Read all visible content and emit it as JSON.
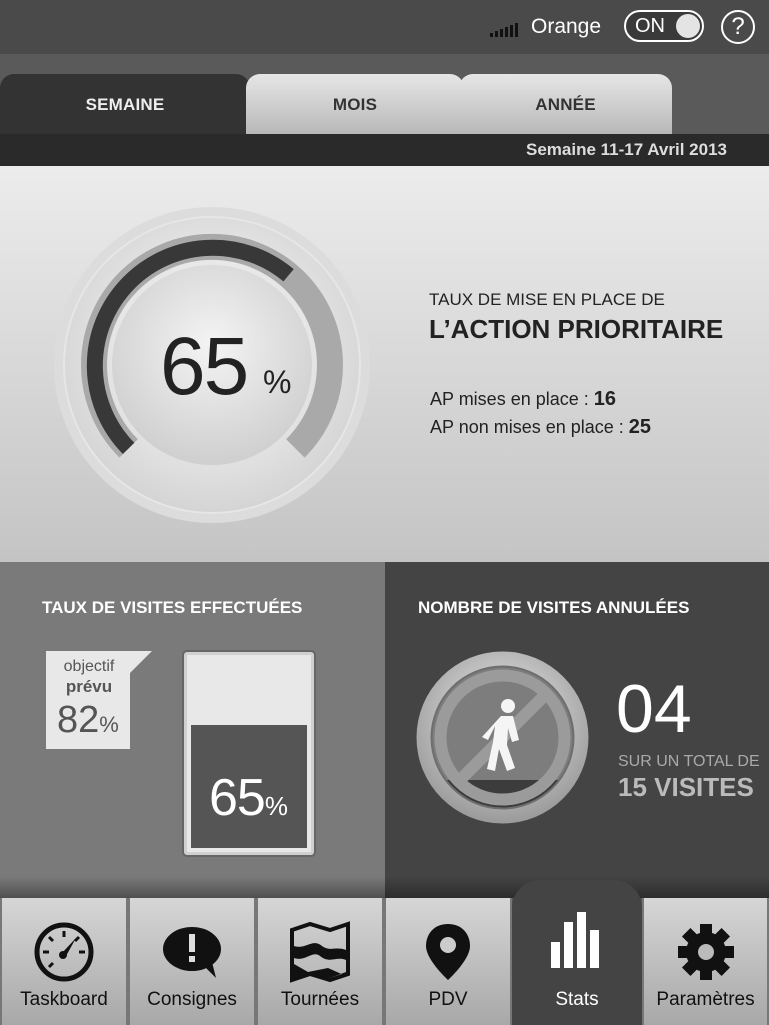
{
  "status": {
    "carrier": "Orange",
    "toggle_label": "ON",
    "help_label": "?"
  },
  "tabs": [
    {
      "label": "SEMAINE",
      "active": true
    },
    {
      "label": "MOIS",
      "active": false
    },
    {
      "label": "ANNÉE",
      "active": false
    }
  ],
  "period": "Semaine 11-17 Avril 2013",
  "action": {
    "percent": "65",
    "percent_symbol": "%",
    "percent_value": 0.65,
    "label": "TAUX DE MISE EN PLACE DE",
    "title": "L’ACTION PRIORITAIRE",
    "mises_label": "AP mises en place :",
    "mises_value": "16",
    "non_mises_label": "AP non mises en place :",
    "non_mises_value": "25"
  },
  "visits": {
    "title": "TAUX DE VISITES EFFECTUÉES",
    "objective_line1": "objectif",
    "objective_line2": "prévu",
    "objective_value": "82",
    "objective_symbol": "%",
    "value": "65",
    "value_symbol": "%",
    "fill_fraction": 0.65
  },
  "cancelled": {
    "title": "NOMBRE DE VISITES ANNULÉES",
    "count": "04",
    "total_label": "SUR UN TOTAL DE",
    "total_value": "15 VISITES"
  },
  "nav": [
    {
      "label": "Taskboard",
      "icon": "speedometer-icon"
    },
    {
      "label": "Consignes",
      "icon": "alert-bubble-icon"
    },
    {
      "label": "Tournées",
      "icon": "map-icon"
    },
    {
      "label": "PDV",
      "icon": "map-pin-icon"
    },
    {
      "label": "Stats",
      "icon": "bar-chart-icon",
      "active": true
    },
    {
      "label": "Paramètres",
      "icon": "gear-icon"
    }
  ]
}
